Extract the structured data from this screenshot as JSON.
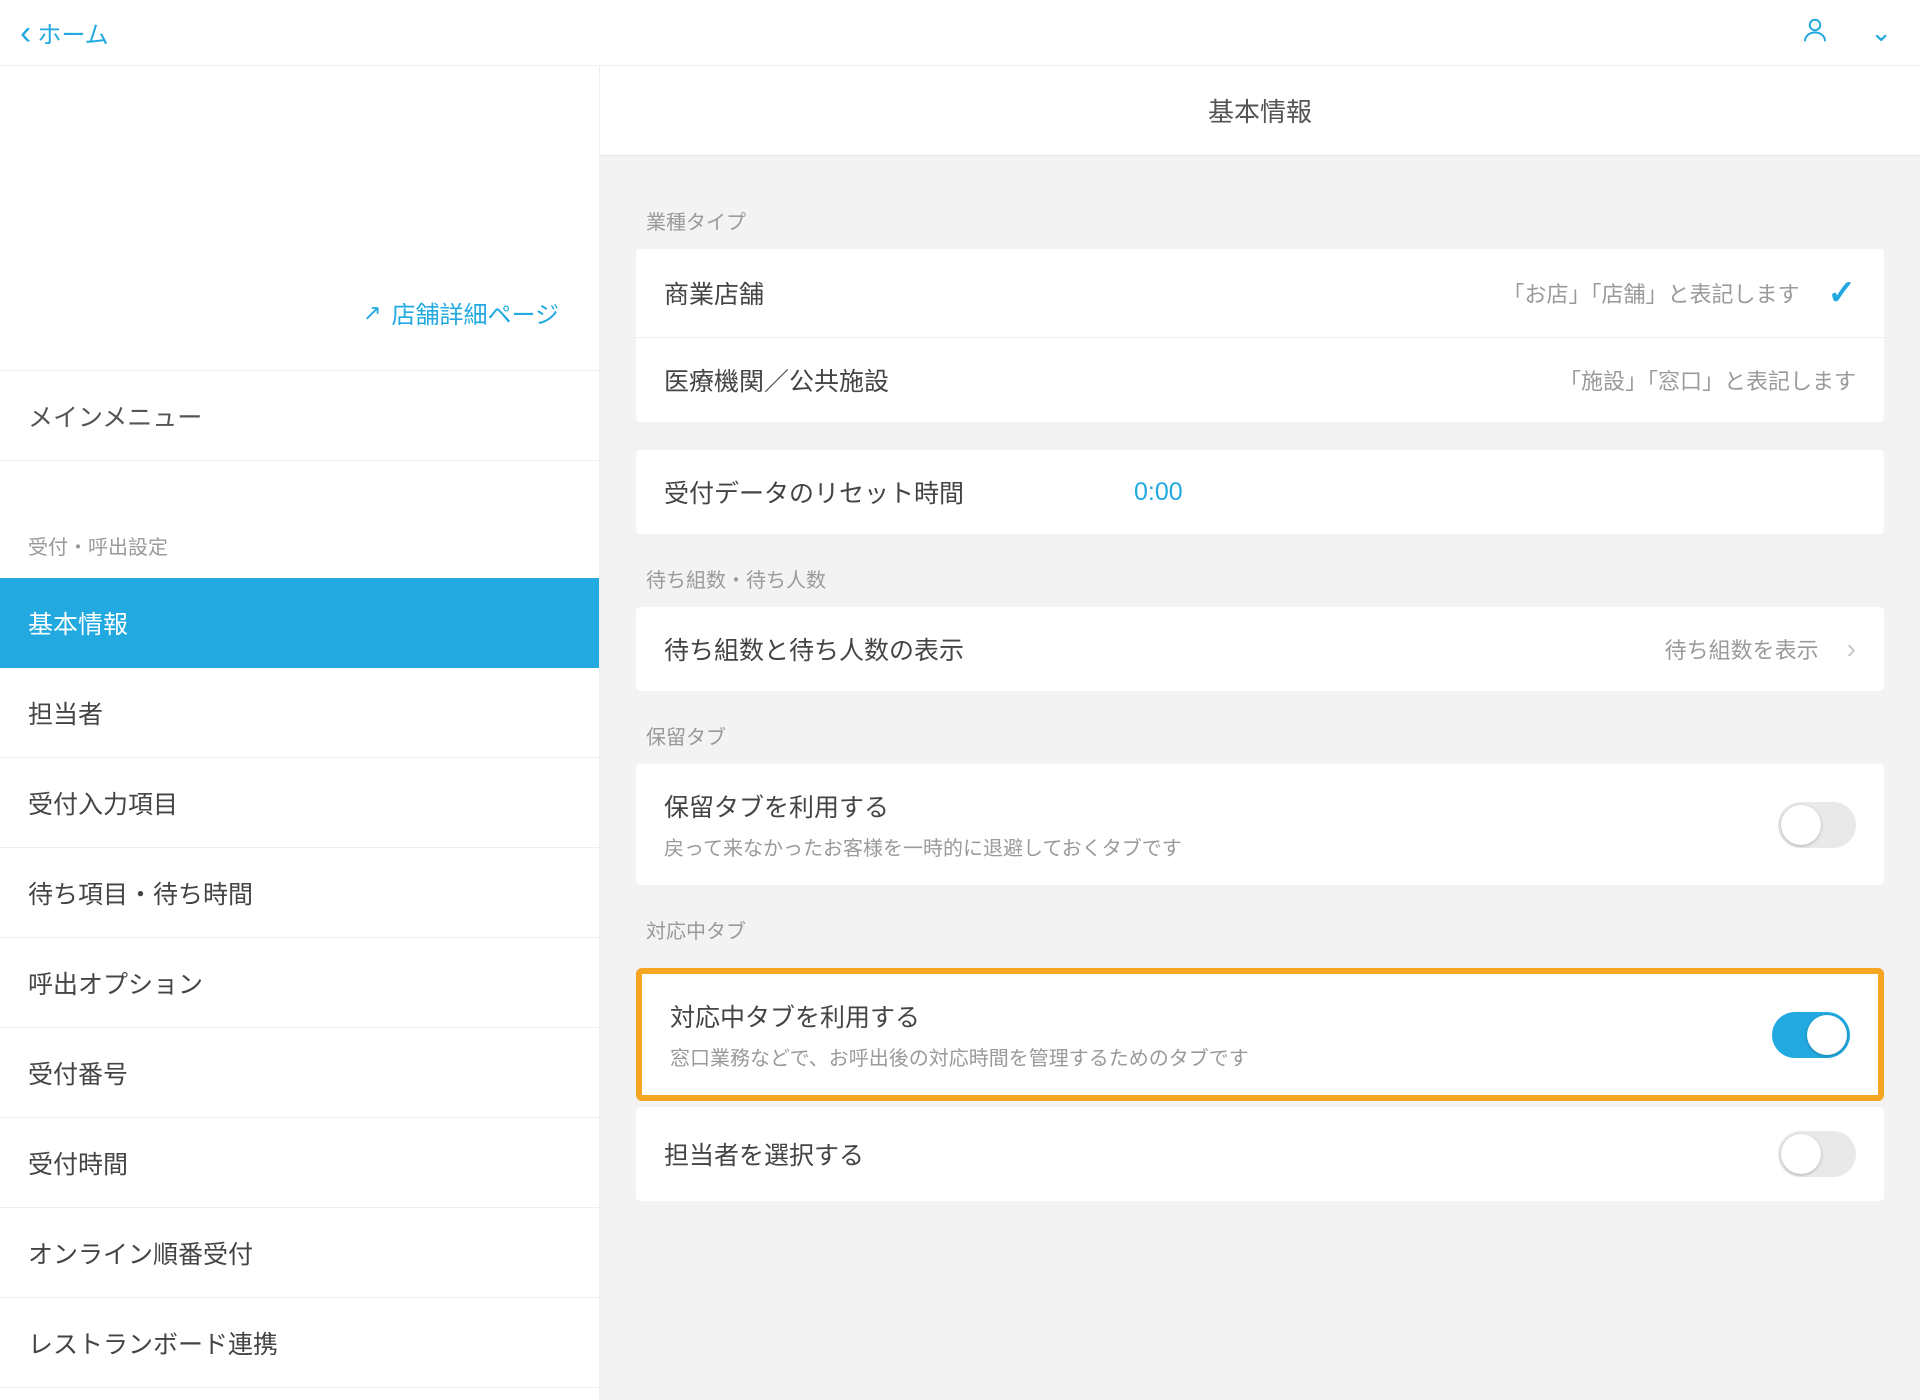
{
  "topbar": {
    "back_label": "ホーム"
  },
  "sidebar": {
    "store_detail_link": "店舗詳細ページ",
    "main_menu": "メインメニュー",
    "section_label": "受付・呼出設定",
    "items": [
      {
        "label": "基本情報",
        "active": true
      },
      {
        "label": "担当者"
      },
      {
        "label": "受付入力項目"
      },
      {
        "label": "待ち項目・待ち時間"
      },
      {
        "label": "呼出オプション"
      },
      {
        "label": "受付番号"
      },
      {
        "label": "受付時間"
      },
      {
        "label": "オンライン順番受付"
      },
      {
        "label": "レストランボード連携"
      }
    ]
  },
  "main": {
    "header": "基本情報",
    "business_type": {
      "label": "業種タイプ",
      "options": [
        {
          "title": "商業店舗",
          "sub": "「お店」「店舗」と表記します",
          "selected": true
        },
        {
          "title": "医療機関／公共施設",
          "sub": "「施設」「窓口」と表記します",
          "selected": false
        }
      ]
    },
    "reset_time": {
      "title": "受付データのリセット時間",
      "value": "0:00"
    },
    "wait_count": {
      "label": "待ち組数・待ち人数",
      "row_title": "待ち組数と待ち人数の表示",
      "row_value": "待ち組数を表示"
    },
    "hold_tab": {
      "label": "保留タブ",
      "title": "保留タブを利用する",
      "desc": "戻って来なかったお客様を一時的に退避しておくタブです",
      "on": false
    },
    "handling_tab": {
      "label": "対応中タブ",
      "title": "対応中タブを利用する",
      "desc": "窓口業務などで、お呼出後の対応時間を管理するためのタブです",
      "on": true
    },
    "select_staff": {
      "title": "担当者を選択する",
      "on": false
    }
  }
}
